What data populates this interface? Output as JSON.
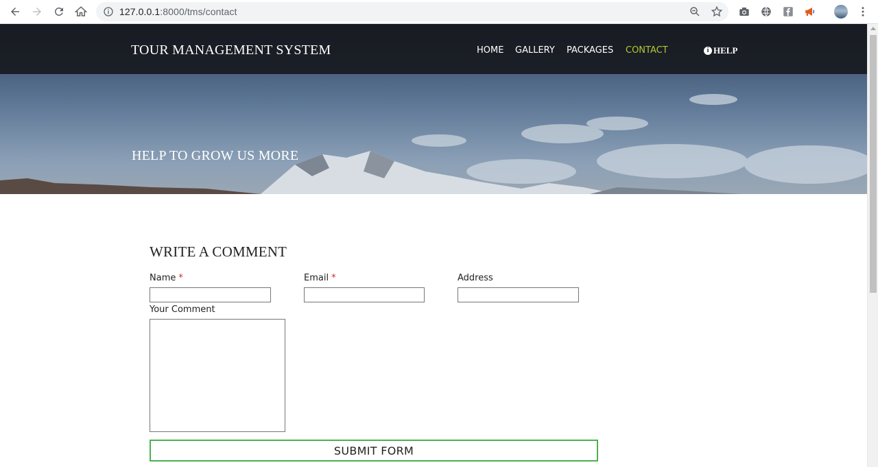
{
  "browser": {
    "url_host": "127.0.0.1",
    "url_path": ":8000/tms/contact"
  },
  "site": {
    "brand": "TOUR MANAGEMENT SYSTEM",
    "nav": {
      "home": "HOME",
      "gallery": "GALLERY",
      "packages": "PACKAGES",
      "contact": "CONTACT",
      "help": "HELP"
    },
    "active_nav": "contact",
    "accent_color": "#b5c832",
    "hero_title": "HELP TO GROW US MORE"
  },
  "form": {
    "title": "WRITE A COMMENT",
    "name_label": "Name",
    "email_label": "Email",
    "address_label": "Address",
    "comment_label": "Your Comment",
    "required_mark": "*",
    "name_value": "",
    "email_value": "",
    "address_value": "",
    "comment_value": "",
    "submit_label": "SUBMIT FORM",
    "submit_border_color": "#4caf50"
  }
}
